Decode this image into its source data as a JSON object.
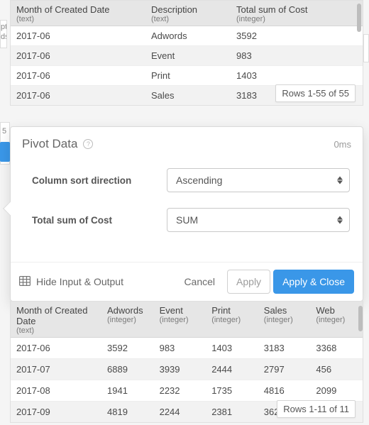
{
  "input_table": {
    "columns": [
      {
        "label": "Month of Created Date",
        "type": "(text)"
      },
      {
        "label": "Description",
        "type": "(text)"
      },
      {
        "label": "Total sum of Cost",
        "type": "(integer)"
      }
    ],
    "rows": [
      {
        "month": "2017-06",
        "desc": "Adwords",
        "cost": "3592"
      },
      {
        "month": "2017-06",
        "desc": "Event",
        "cost": "983"
      },
      {
        "month": "2017-06",
        "desc": "Print",
        "cost": "1403"
      },
      {
        "month": "2017-06",
        "desc": "Sales",
        "cost": "3183"
      }
    ],
    "row_counter": "Rows 1-55 of 55"
  },
  "bg": {
    "frag1a": "ptic",
    "frag1b": "ds",
    "frag2": "5"
  },
  "modal": {
    "title": "Pivot Data",
    "timing": "0ms",
    "fields": {
      "sort_direction_label": "Column sort direction",
      "sort_direction_value": "Ascending",
      "aggregate_label": "Total sum of Cost",
      "aggregate_value": "SUM"
    },
    "footer": {
      "hide_label": "Hide Input & Output",
      "cancel": "Cancel",
      "apply": "Apply",
      "apply_close": "Apply & Close"
    }
  },
  "output_table": {
    "columns": [
      {
        "label": "Month of Created Date",
        "type": "(text)"
      },
      {
        "label": "Adwords",
        "type": "(integer)"
      },
      {
        "label": "Event",
        "type": "(integer)"
      },
      {
        "label": "Print",
        "type": "(integer)"
      },
      {
        "label": "Sales",
        "type": "(integer)"
      },
      {
        "label": "Web",
        "type": "(integer)"
      }
    ],
    "rows": [
      {
        "c0": "2017-06",
        "c1": "3592",
        "c2": "983",
        "c3": "1403",
        "c4": "3183",
        "c5": "3368"
      },
      {
        "c0": "2017-07",
        "c1": "6889",
        "c2": "3939",
        "c3": "2444",
        "c4": "2797",
        "c5": "456"
      },
      {
        "c0": "2017-08",
        "c1": "1941",
        "c2": "2232",
        "c3": "1735",
        "c4": "4816",
        "c5": "2099"
      },
      {
        "c0": "2017-09",
        "c1": "4819",
        "c2": "2244",
        "c3": "2381",
        "c4": "362",
        "c5": ""
      }
    ],
    "row_counter": "Rows 1-11 of 11"
  }
}
